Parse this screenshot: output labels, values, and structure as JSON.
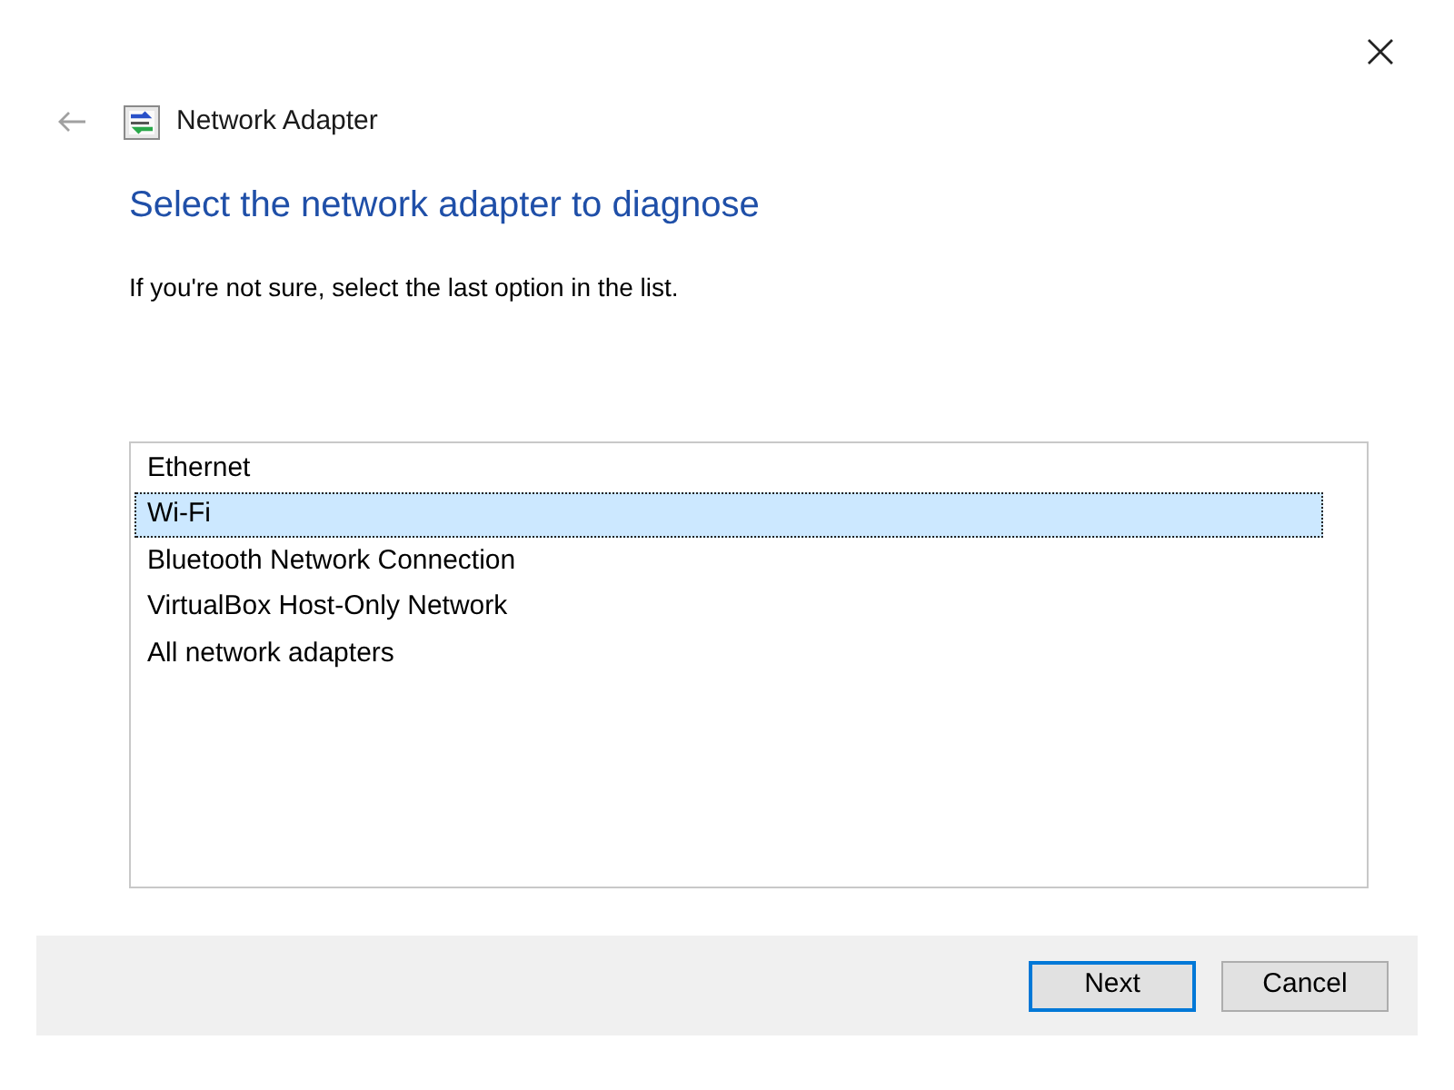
{
  "window": {
    "title": "Network Adapter"
  },
  "heading": "Select the network adapter to diagnose",
  "instruction": "If you're not sure, select the last option in the list.",
  "adapters": [
    {
      "label": "Ethernet",
      "selected": false
    },
    {
      "label": "Wi-Fi",
      "selected": true
    },
    {
      "label": "Bluetooth Network Connection",
      "selected": false
    },
    {
      "label": "VirtualBox Host-Only Network",
      "selected": false
    },
    {
      "label": "All network adapters",
      "selected": false
    }
  ],
  "buttons": [
    {
      "label": "Next",
      "default": true
    },
    {
      "label": "Cancel",
      "default": false
    }
  ]
}
